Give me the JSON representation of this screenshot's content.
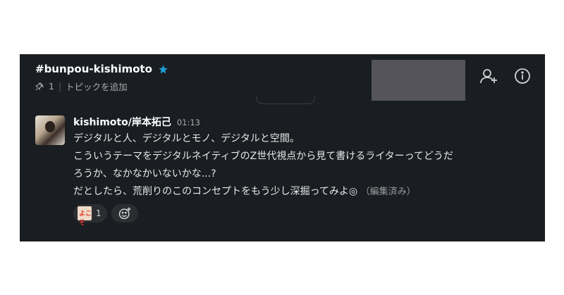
{
  "channel": {
    "name": "#bunpou-kishimoto",
    "pins": "1",
    "add_topic": "トピックを追加"
  },
  "message": {
    "author": "kishimoto/岸本拓己",
    "time": "01:13",
    "lines": [
      "デジタルと人、デジタルとモノ、デジタルと空間。",
      "こういうテーマをデジタルネイティブのZ世代視点から見て書けるライターってどうだ",
      "ろうか、なかなかいないかな...?",
      "だとしたら、荒削りのこのコンセプトをもう少し深掘ってみよ◎"
    ],
    "edited": "（編集済み）"
  },
  "reactions": [
    {
      "emoji": "yokoso-emoji",
      "emoji_text": "よこそ",
      "count": "1"
    }
  ],
  "icons": {
    "star": "star-icon",
    "pin": "pin-icon",
    "add_person": "add-person-icon",
    "info": "info-icon",
    "add_reaction": "add-reaction-icon"
  },
  "colors": {
    "panel_bg": "#1a1d21",
    "star": "#1d9bd1",
    "text": "#e8e8e8",
    "muted": "#ababad"
  }
}
